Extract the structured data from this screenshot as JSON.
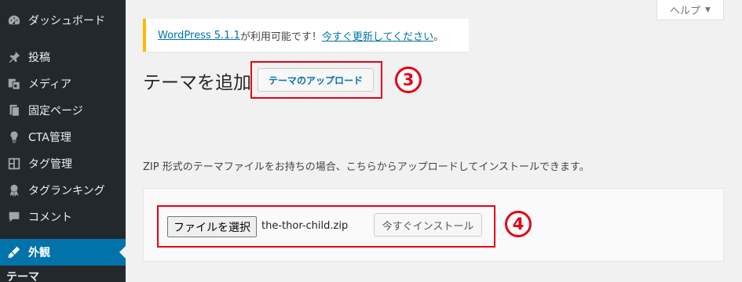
{
  "sidebar": {
    "items": [
      {
        "label": "ダッシュボード",
        "icon": "dashboard-icon"
      },
      {
        "label": "投稿",
        "icon": "pin-icon"
      },
      {
        "label": "メディア",
        "icon": "media-icon"
      },
      {
        "label": "固定ページ",
        "icon": "page-icon"
      },
      {
        "label": "CTA管理",
        "icon": "lightbulb-icon"
      },
      {
        "label": "タグ管理",
        "icon": "layout-icon"
      },
      {
        "label": "タグランキング",
        "icon": "award-icon"
      },
      {
        "label": "コメント",
        "icon": "comment-icon"
      },
      {
        "label": "外観",
        "icon": "appearance-icon",
        "active": true
      },
      {
        "label": "テーマ",
        "icon": ""
      }
    ]
  },
  "help": {
    "label": "ヘルプ",
    "caret": "▼"
  },
  "notice": {
    "link1": "WordPress 5.1.1",
    "text": " が利用可能です！",
    "link2": "今すぐ更新してください",
    "end": "。"
  },
  "page": {
    "title": "テーマを追加",
    "upload_button": "テーマのアップロード",
    "help_text": "ZIP 形式のテーマファイルをお持ちの場合、こちらからアップロードしてインストールできます。"
  },
  "upload": {
    "file_button": "ファイルを選択",
    "file_name": "the-thor-child.zip",
    "install_button": "今すぐインストール"
  },
  "annotations": {
    "step3": "3",
    "step4": "4"
  },
  "colors": {
    "accent": "#0073aa",
    "sidebar": "#23282d",
    "annotation": "#e60012",
    "notice_border": "#ffb900"
  }
}
